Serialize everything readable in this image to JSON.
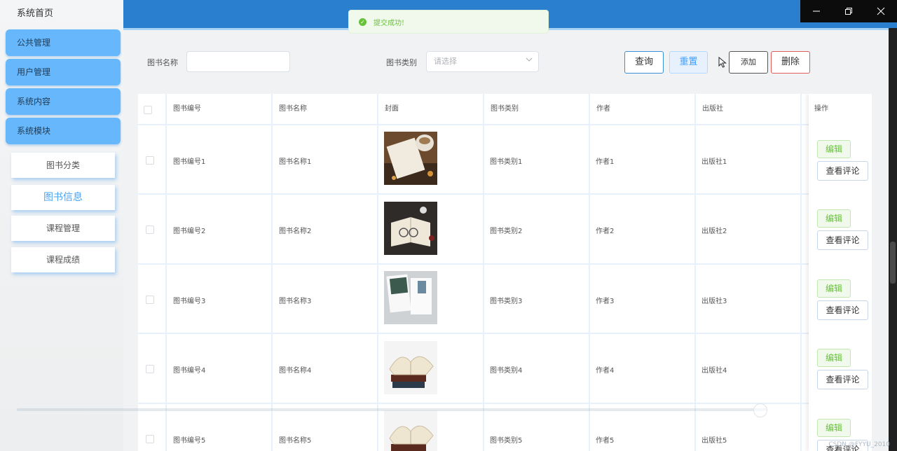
{
  "sidebar": {
    "home": "系统首页",
    "menus": [
      "公共管理",
      "用户管理",
      "系统内容",
      "系统模块"
    ],
    "sub_items": [
      "图书分类",
      "图书信息",
      "课程管理",
      "课程成绩"
    ],
    "active_sub": "图书信息"
  },
  "toast": {
    "message": "提交成功!",
    "icon": "check-circle-icon"
  },
  "search": {
    "name_label": "图书名称",
    "name_value": "",
    "category_label": "图书类别",
    "category_placeholder": "请选择"
  },
  "buttons": {
    "query": "查询",
    "reset": "重置",
    "add": "添加",
    "delete": "删除"
  },
  "table": {
    "columns": [
      "图书编号",
      "图书名称",
      "封面",
      "图书类别",
      "作者",
      "出版社",
      "操作"
    ],
    "rows": [
      {
        "id": "图书编号1",
        "name": "图书名称1",
        "category": "图书类别1",
        "author": "作者1",
        "publisher": "出版社1"
      },
      {
        "id": "图书编号2",
        "name": "图书名称2",
        "category": "图书类别2",
        "author": "作者2",
        "publisher": "出版社2"
      },
      {
        "id": "图书编号3",
        "name": "图书名称3",
        "category": "图书类别3",
        "author": "作者3",
        "publisher": "出版社3"
      },
      {
        "id": "图书编号4",
        "name": "图书名称4",
        "category": "图书类别4",
        "author": "作者4",
        "publisher": "出版社4"
      },
      {
        "id": "图书编号5",
        "name": "图书名称5",
        "category": "图书类别5",
        "author": "作者5",
        "publisher": "出版社5"
      }
    ],
    "edit_label": "编辑",
    "review_label": "查看评论"
  },
  "watermark": "CSDN @FYYU_2010",
  "colors": {
    "accent": "#2a7fce",
    "menu": "#66b7fb",
    "success": "#67c23a",
    "danger": "#e25c5c"
  }
}
